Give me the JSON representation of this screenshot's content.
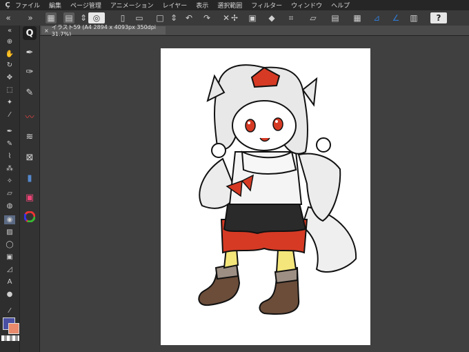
{
  "app": {
    "logo": "Ç"
  },
  "menu": {
    "items": [
      "ファイル",
      "編集",
      "ページ管理",
      "アニメーション",
      "レイヤー",
      "表示",
      "選択範囲",
      "フィルター",
      "ウィンドウ",
      "ヘルプ"
    ]
  },
  "document": {
    "tab_title": "イラスト59 (A4 2894 x 4093px 350dpi 31.7%)",
    "tab_close": "×"
  },
  "toolbar": {
    "collapse_left": "«",
    "collapse_right": "»",
    "help": "?"
  },
  "colors": {
    "main": "#4a4fa3",
    "sub": "#e98a6c",
    "ui_bg": "#3c3c3c",
    "paper": "#ffffff"
  }
}
